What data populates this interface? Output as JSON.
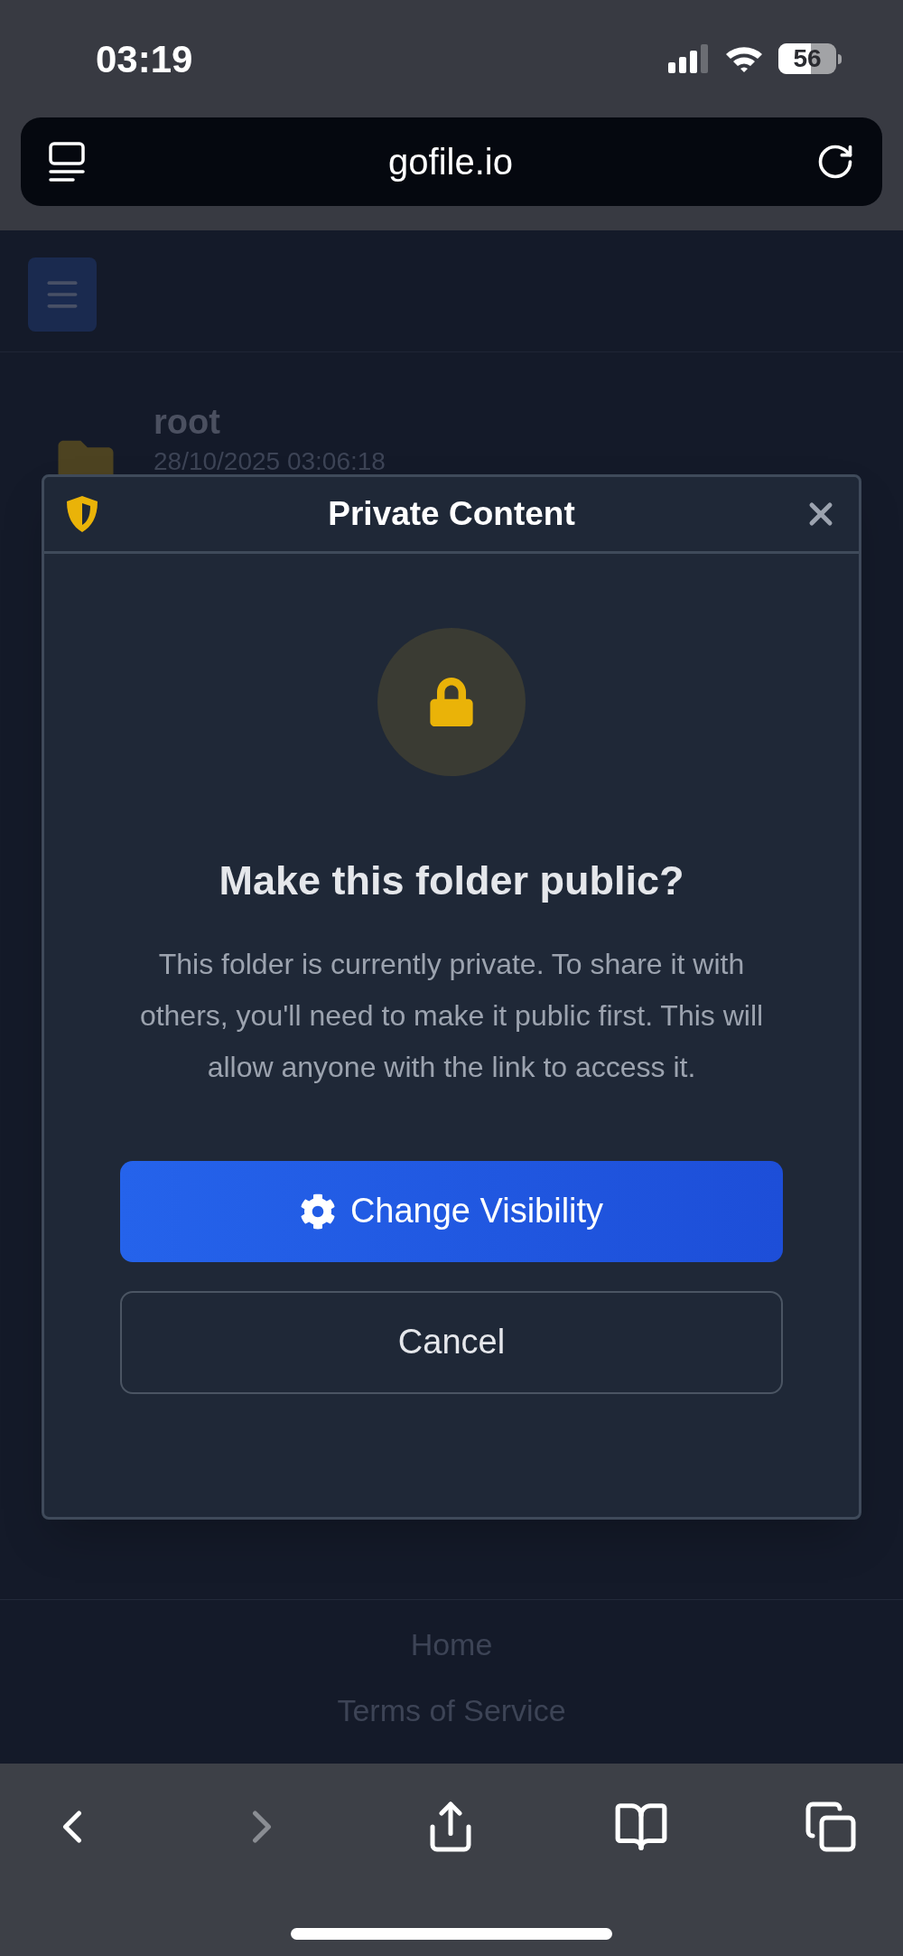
{
  "status_bar": {
    "time": "03:19",
    "battery": "56"
  },
  "address_bar": {
    "url": "gofile.io"
  },
  "page": {
    "folder": {
      "name": "root",
      "date": "28/10/2025 03:06:18"
    },
    "footer_links": [
      "Home",
      "Terms of Service"
    ]
  },
  "dialog": {
    "title": "Private Content",
    "heading": "Make this folder public?",
    "message": "This folder is currently private. To share it with others, you'll need to make it public first. This will allow anyone with the link to access it.",
    "buttons": [
      {
        "label": "Change Visibility",
        "kind": "primary"
      },
      {
        "label": "Cancel",
        "kind": "secondary"
      }
    ]
  },
  "toolbar": {
    "back": {
      "disabled": false
    },
    "forward": {
      "disabled": true
    }
  }
}
